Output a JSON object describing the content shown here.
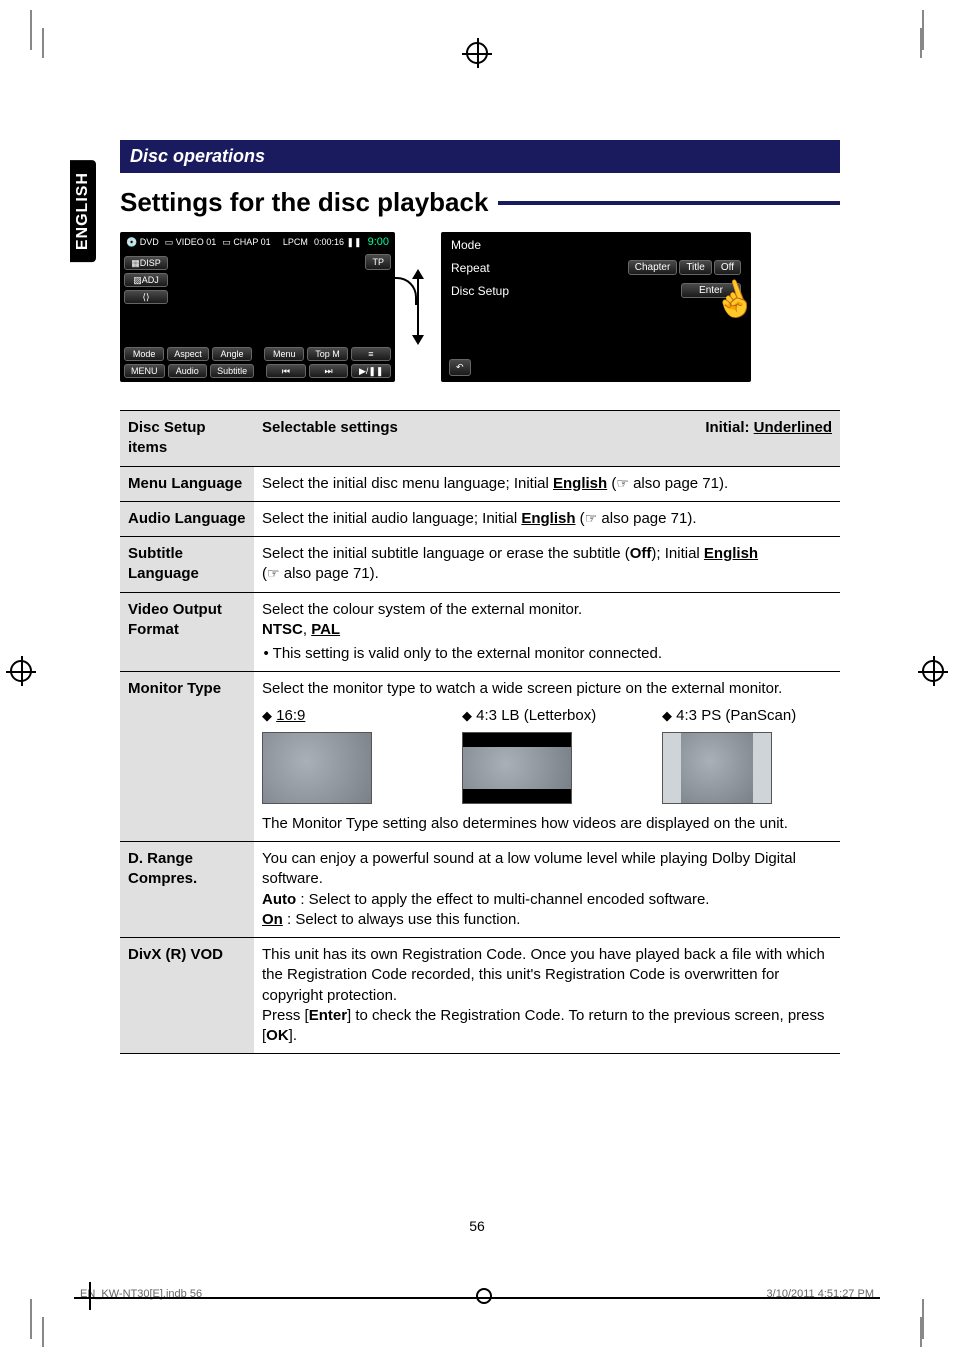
{
  "lang_tab": "ENGLISH",
  "section_header": "Disc operations",
  "page_title": "Settings for the disc playback",
  "screen1": {
    "disc_label": "DVD",
    "video_label": "VIDEO",
    "title_num": "01",
    "chap_label": "CHAP",
    "chap_num": "01",
    "audio_label": "LPCM",
    "time": "0:00:16",
    "pause_glyph": "❚❚",
    "clock": "9:00",
    "tp": "TP",
    "sidebar": {
      "disp": "DISP",
      "adj": "ADJ",
      "nav_glyph": "⟨⟩"
    },
    "bottom1": {
      "mode": "Mode",
      "aspect": "Aspect",
      "angle": "Angle",
      "menu": "Menu",
      "topm": "Top M",
      "list_glyph": "≡"
    },
    "bottom2": {
      "menu2": "MENU",
      "audio": "Audio",
      "subtitle": "Subtitle",
      "prev_glyph": "⏮",
      "next_glyph": "⏭",
      "playpause_glyph": "▶/❚❚"
    }
  },
  "screen2": {
    "rows": {
      "mode_label": "Mode",
      "repeat_label": "Repeat",
      "disc_setup_label": "Disc Setup"
    },
    "repeat_opts": {
      "chapter": "Chapter",
      "title": "Title",
      "off": "Off"
    },
    "enter": "Enter",
    "back_glyph": "↶"
  },
  "cursor_glyph": "☝",
  "table": {
    "header": {
      "c1": "Disc Setup items",
      "c2": "Selectable settings",
      "c3": "Initial: ",
      "c3b": "Underlined"
    },
    "rows": {
      "menu_lang": {
        "label": "Menu Language",
        "desc_a": "Select the initial disc menu language; Initial ",
        "desc_b": "English",
        "desc_c": " (",
        "desc_d": " also page 71)."
      },
      "audio_lang": {
        "label": "Audio Language",
        "desc_a": "Select the initial audio language; Initial ",
        "desc_b": "English",
        "desc_c": " (",
        "desc_d": " also page 71)."
      },
      "sub_lang": {
        "label": "Subtitle Language",
        "desc_a": "Select the initial subtitle language or erase the subtitle (",
        "desc_b": "Off",
        "desc_c": "); Initial ",
        "desc_d": "English",
        "line2_a": "(",
        "line2_b": " also page 71)."
      },
      "video_out": {
        "label": "Video Output Format",
        "l1": "Select the colour system of the external monitor.",
        "opts_a": "NTSC",
        "opts_sep": ", ",
        "opts_b": "PAL",
        "bullet": "This setting is valid only to the external monitor connected."
      },
      "monitor": {
        "label": "Monitor Type",
        "l1": "Select the monitor type to watch a wide screen picture on the external monitor.",
        "opt1": "16:9",
        "opt2": "4:3 LB (Letterbox)",
        "opt3": "4:3 PS (PanScan)",
        "foot": "The Monitor Type setting also determines how videos are displayed on the unit."
      },
      "drange": {
        "label": "D. Range Compres.",
        "l1": "You can enjoy a powerful sound at a low volume level while playing Dolby Digital software.",
        "l2a": "Auto",
        "l2b": " : Select to apply the effect to multi-channel encoded software.",
        "l3a": "On",
        "l3b": " : Select to always use this function."
      },
      "divx": {
        "label": "DivX (R) VOD",
        "l1": "This unit has its own Registration Code. Once you have played back a file with which the Registration Code recorded, this unit's Registration Code is overwritten for copyright protection.",
        "l2a": "Press [",
        "l2b": "Enter",
        "l2c": "] to check the Registration Code. To return to the previous screen, press [",
        "l2d": "OK",
        "l2e": "]."
      }
    }
  },
  "hand_glyph": "☞",
  "page_number": "56",
  "footer_left": "EN_KW-NT30[E].indb   56",
  "footer_right": "3/10/2011   4:51:27 PM"
}
